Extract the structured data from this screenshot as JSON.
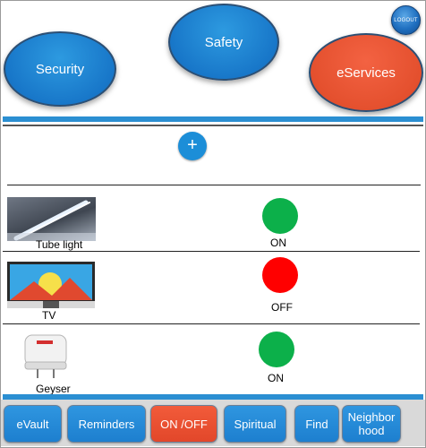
{
  "header": {
    "categories": [
      {
        "label": "Security",
        "color": "#1877c9"
      },
      {
        "label": "Safety",
        "color": "#1877c9"
      },
      {
        "label": "eServices",
        "color": "#e4502e"
      }
    ],
    "logout_label": "LOGOUT"
  },
  "add_button_label": "+",
  "devices": [
    {
      "name": "Tube light",
      "status": "ON",
      "status_color": "#0cb04a",
      "icon": "tube-light-icon"
    },
    {
      "name": "TV",
      "status": "OFF",
      "status_color": "#ff0000",
      "icon": "tv-icon"
    },
    {
      "name": "Geyser",
      "status": "ON",
      "status_color": "#0cb04a",
      "icon": "geyser-icon"
    }
  ],
  "nav": {
    "items": [
      {
        "label": "eVault"
      },
      {
        "label": "Reminders"
      },
      {
        "label": "ON /OFF"
      },
      {
        "label": "Spiritual"
      },
      {
        "label": "Find"
      },
      {
        "label": "Neighbor hood"
      }
    ]
  },
  "colors": {
    "accent": "#2b8fd2",
    "active": "#e4502e",
    "on": "#0cb04a",
    "off": "#ff0000"
  }
}
